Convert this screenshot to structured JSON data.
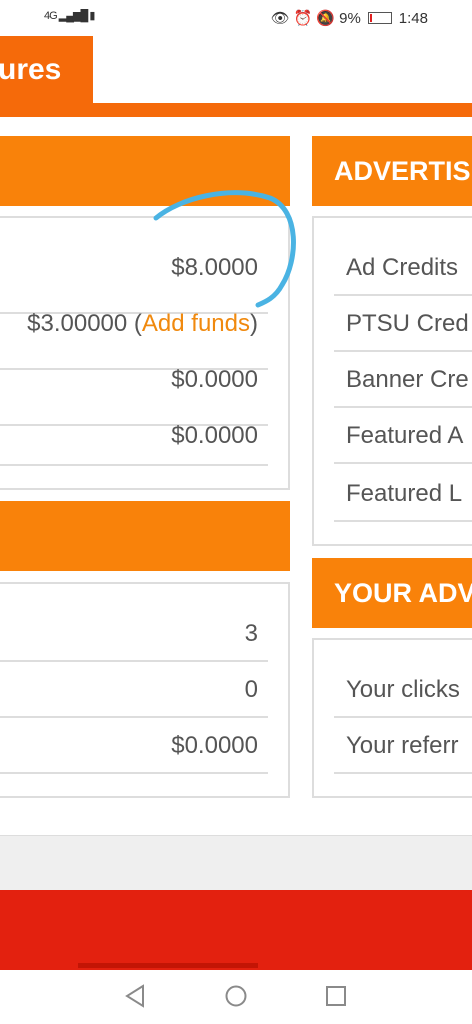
{
  "status_bar": {
    "network": "4G",
    "battery_text": "9%",
    "time": "1:48",
    "battery_level": 0.09
  },
  "tab": {
    "label": "ures"
  },
  "left_top_panel": {
    "rows": [
      {
        "value": "$8.0000"
      },
      {
        "value": "$3.00000 (",
        "link": "Add funds",
        "tail": ")"
      },
      {
        "value": "$0.0000"
      },
      {
        "value": "$0.0000"
      }
    ]
  },
  "left_bottom_panel": {
    "rows": [
      {
        "value": "3"
      },
      {
        "value": "0"
      },
      {
        "value": "$0.0000"
      }
    ]
  },
  "right_top_panel": {
    "header": "ADVERTIS",
    "rows": [
      "Ad Credits",
      "PTSU Cred",
      "Banner Cre",
      "Featured A",
      "Featured L"
    ]
  },
  "right_bottom_panel": {
    "header": "YOUR ADV",
    "rows": [
      "Your clicks",
      "Your referr"
    ]
  },
  "colors": {
    "orange_tab": "#f56a0a",
    "orange_header": "#f9820a",
    "link": "#f0890e",
    "red_band": "#e3210f",
    "annotation": "#4ab3e3"
  },
  "icons": {
    "nav_back": "back-triangle-icon",
    "nav_home": "home-circle-icon",
    "nav_recent": "recent-square-icon"
  }
}
